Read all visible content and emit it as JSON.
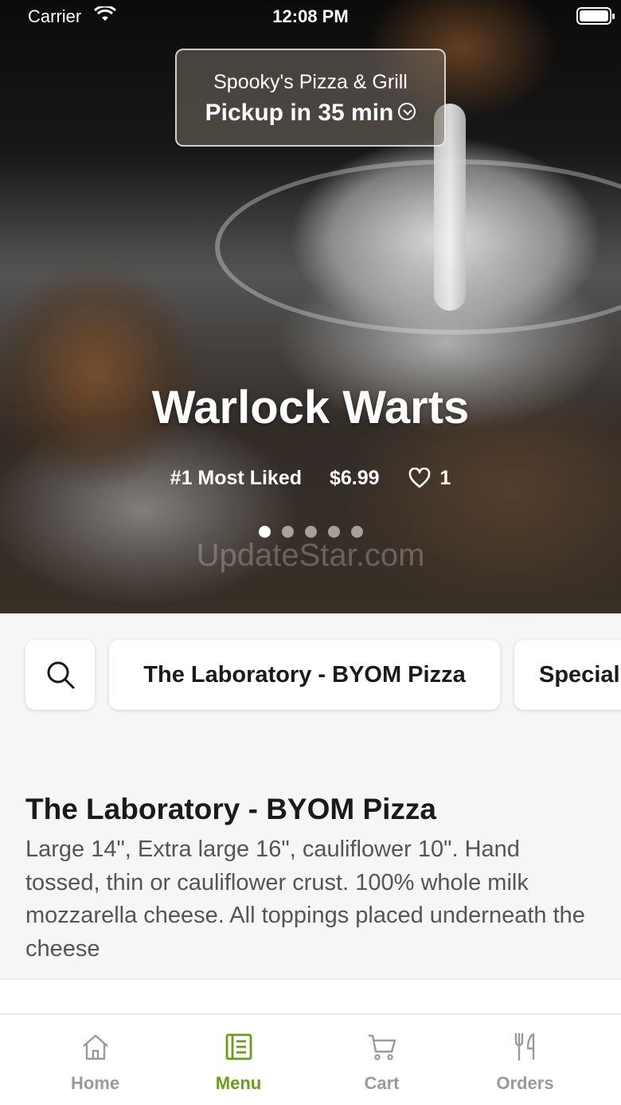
{
  "status_bar": {
    "carrier": "Carrier",
    "time": "12:08 PM"
  },
  "pickup": {
    "store_name": "Spooky's Pizza & Grill",
    "eta": "Pickup in 35 min"
  },
  "featured": {
    "title": "Warlock Warts",
    "rank": "#1 Most Liked",
    "price": "$6.99",
    "likes": "1",
    "carousel": {
      "count": 5,
      "active_index": 0
    },
    "watermark": "UpdateStar.com"
  },
  "categories": [
    {
      "label": "The Laboratory - BYOM Pizza"
    },
    {
      "label": "Special"
    }
  ],
  "section": {
    "title": "The Laboratory - BYOM Pizza",
    "description": "Large 14\", Extra large 16\", cauliflower 10\". Hand tossed, thin or cauliflower crust. 100% whole milk mozzarella cheese. All toppings placed underneath the cheese"
  },
  "tabbar": {
    "items": [
      {
        "label": "Home",
        "icon": "home-icon"
      },
      {
        "label": "Menu",
        "icon": "menu-icon"
      },
      {
        "label": "Cart",
        "icon": "cart-icon"
      },
      {
        "label": "Orders",
        "icon": "orders-icon"
      }
    ],
    "active": "Menu",
    "accent_color": "#6b9a1f",
    "inactive_color": "#9a9a9a"
  }
}
